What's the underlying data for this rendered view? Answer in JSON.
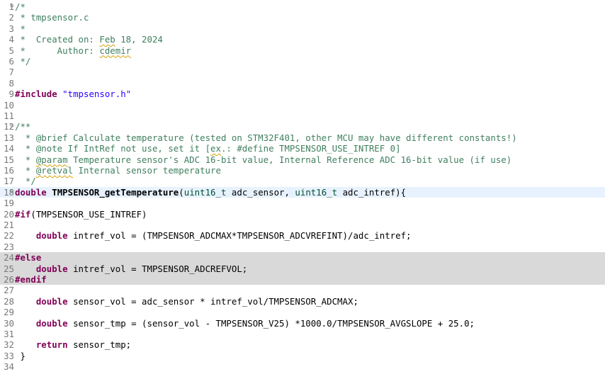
{
  "editor": {
    "file_name": "tmpsensor.c",
    "selected_symbol": "TMPSENSOR_getTemperature",
    "lines": [
      {
        "n": "1",
        "fold": "⊖",
        "tokens": [
          {
            "t": "/*",
            "c": "comment"
          }
        ]
      },
      {
        "n": "2",
        "tokens": [
          {
            "t": " * tmpsensor.c",
            "c": "comment"
          }
        ]
      },
      {
        "n": "3",
        "tokens": [
          {
            "t": " *",
            "c": "comment"
          }
        ]
      },
      {
        "n": "4",
        "tokens": [
          {
            "t": " *  Created on: ",
            "c": "comment"
          },
          {
            "t": "Feb",
            "c": "comment spell"
          },
          {
            "t": " 18, 2024",
            "c": "comment"
          }
        ]
      },
      {
        "n": "5",
        "tokens": [
          {
            "t": " *      Author: ",
            "c": "comment"
          },
          {
            "t": "cdemir",
            "c": "comment spell"
          }
        ]
      },
      {
        "n": "6",
        "tokens": [
          {
            "t": " */",
            "c": "comment"
          }
        ]
      },
      {
        "n": "7",
        "tokens": []
      },
      {
        "n": "8",
        "tokens": []
      },
      {
        "n": "9",
        "tokens": [
          {
            "t": "#include",
            "c": "kw"
          },
          {
            "t": " "
          },
          {
            "t": "\"tmpsensor.h\"",
            "c": "str"
          }
        ]
      },
      {
        "n": "10",
        "tokens": []
      },
      {
        "n": "11",
        "tokens": []
      },
      {
        "n": "12",
        "fold": "⊖",
        "tokens": [
          {
            "t": "/**",
            "c": "comment"
          }
        ]
      },
      {
        "n": "13",
        "tokens": [
          {
            "t": "  * ",
            "c": "comment"
          },
          {
            "t": "@brief",
            "c": "comment"
          },
          {
            "t": " Calculate temperature (tested on STM32F401, other MCU may have different constants!)",
            "c": "comment"
          }
        ]
      },
      {
        "n": "14",
        "tokens": [
          {
            "t": "  * ",
            "c": "comment"
          },
          {
            "t": "@note",
            "c": "comment"
          },
          {
            "t": " If IntRef not use, set it [",
            "c": "comment"
          },
          {
            "t": "ex",
            "c": "comment spell"
          },
          {
            "t": ".: #define TMPSENSOR_USE_INTREF 0]",
            "c": "comment"
          }
        ]
      },
      {
        "n": "15",
        "tokens": [
          {
            "t": "  * ",
            "c": "comment"
          },
          {
            "t": "@param",
            "c": "comment spell"
          },
          {
            "t": " Temperature sensor's ADC 16-bit value, Internal Reference ADC 16-bit value (if use)",
            "c": "comment"
          }
        ]
      },
      {
        "n": "16",
        "tokens": [
          {
            "t": "  * ",
            "c": "comment"
          },
          {
            "t": "@retval",
            "c": "comment spell"
          },
          {
            "t": " Internal sensor temperature",
            "c": "comment"
          }
        ]
      },
      {
        "n": "17",
        "tokens": [
          {
            "t": "  */",
            "c": "comment"
          }
        ]
      },
      {
        "n": "18",
        "fold": "⊖",
        "current": true,
        "tokens": [
          {
            "t": "double",
            "c": "kw"
          },
          {
            "t": " "
          },
          {
            "t": "TMPSENSOR_getTemperature",
            "c": "fn sel"
          },
          {
            "t": "("
          },
          {
            "t": "uint16_t",
            "c": "type"
          },
          {
            "t": " adc_sensor, "
          },
          {
            "t": "uint16_t",
            "c": "type"
          },
          {
            "t": " adc_intref){"
          }
        ]
      },
      {
        "n": "19",
        "tokens": []
      },
      {
        "n": "20",
        "tokens": [
          {
            "t": "#if",
            "c": "kw"
          },
          {
            "t": "(TMPSENSOR_USE_INTREF)"
          }
        ]
      },
      {
        "n": "21",
        "tokens": []
      },
      {
        "n": "22",
        "tokens": [
          {
            "t": "    "
          },
          {
            "t": "double",
            "c": "kw"
          },
          {
            "t": " intref_vol = (TMPSENSOR_ADCMAX*TMPSENSOR_ADCVREFINT)/adc_intref;"
          }
        ]
      },
      {
        "n": "23",
        "tokens": []
      },
      {
        "n": "24",
        "inactive": true,
        "tokens": [
          {
            "t": "#else",
            "c": "kw"
          }
        ]
      },
      {
        "n": "25",
        "inactive": true,
        "tokens": [
          {
            "t": "    "
          },
          {
            "t": "double",
            "c": "kw"
          },
          {
            "t": " intref_vol = TMPSENSOR_ADCREFVOL;"
          }
        ]
      },
      {
        "n": "26",
        "inactive": true,
        "tokens": [
          {
            "t": "#endif",
            "c": "kw"
          }
        ]
      },
      {
        "n": "27",
        "tokens": []
      },
      {
        "n": "28",
        "tokens": [
          {
            "t": "    "
          },
          {
            "t": "double",
            "c": "kw"
          },
          {
            "t": " sensor_vol = adc_sensor * intref_vol/TMPSENSOR_ADCMAX;"
          }
        ]
      },
      {
        "n": "29",
        "tokens": []
      },
      {
        "n": "30",
        "tokens": [
          {
            "t": "    "
          },
          {
            "t": "double",
            "c": "kw"
          },
          {
            "t": " sensor_tmp = (sensor_vol - TMPSENSOR_V25) *1000.0/TMPSENSOR_AVGSLOPE + 25.0;"
          }
        ]
      },
      {
        "n": "31",
        "tokens": []
      },
      {
        "n": "32",
        "tokens": [
          {
            "t": "    "
          },
          {
            "t": "return",
            "c": "kw"
          },
          {
            "t": " sensor_tmp;"
          }
        ]
      },
      {
        "n": "33",
        "tokens": [
          {
            "t": " }"
          }
        ]
      },
      {
        "n": "34",
        "tokens": []
      }
    ]
  }
}
